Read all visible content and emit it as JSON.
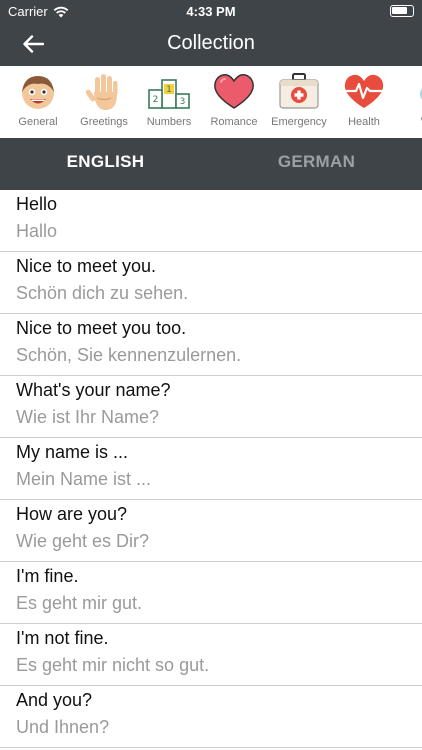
{
  "status_bar": {
    "carrier": "Carrier",
    "time": "4:33 PM"
  },
  "nav": {
    "title": "Collection",
    "back_icon": "arrow-left-icon"
  },
  "categories": [
    {
      "label": "General",
      "icon": "face-icon"
    },
    {
      "label": "Greetings",
      "icon": "hand-icon"
    },
    {
      "label": "Numbers",
      "icon": "podium-icon"
    },
    {
      "label": "Romance",
      "icon": "heart-icon"
    },
    {
      "label": "Emergency",
      "icon": "first-aid-icon"
    },
    {
      "label": "Health",
      "icon": "heartbeat-icon"
    },
    {
      "label": "We",
      "icon": "weather-icon"
    }
  ],
  "language_tabs": {
    "active": "ENGLISH",
    "inactive": "GERMAN"
  },
  "phrases": [
    {
      "en": "Hello",
      "de": "Hallo"
    },
    {
      "en": "Nice to meet you.",
      "de": "Schön dich zu sehen."
    },
    {
      "en": "Nice to meet you too.",
      "de": "Schön, Sie kennenzulernen."
    },
    {
      "en": "What's your name?",
      "de": "Wie ist Ihr Name?"
    },
    {
      "en": "My name is ...",
      "de": "Mein Name ist ..."
    },
    {
      "en": "How are you?",
      "de": "Wie geht es Dir?"
    },
    {
      "en": "I'm fine.",
      "de": "Es geht mir gut."
    },
    {
      "en": "I'm not fine.",
      "de": "Es geht mir nicht so gut."
    },
    {
      "en": "And you?",
      "de": "Und Ihnen?"
    }
  ],
  "colors": {
    "header": "#3f4449",
    "inactive_tab": "#9aa0a6",
    "secondary_text": "#9a9a9a"
  }
}
